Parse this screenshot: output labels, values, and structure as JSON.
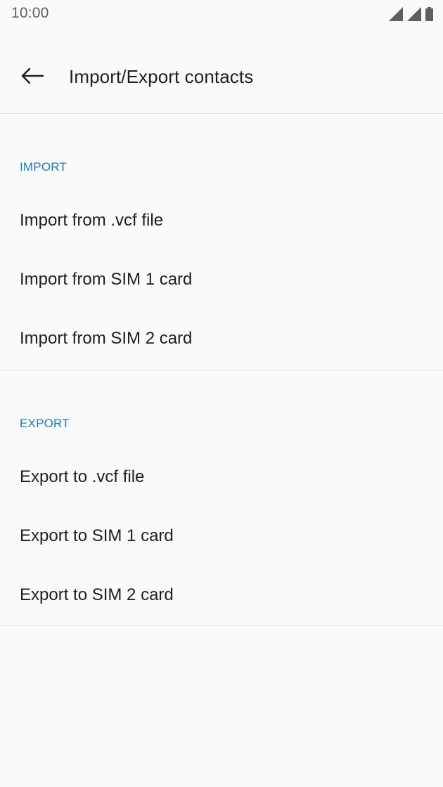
{
  "status_bar": {
    "time": "10:00",
    "icons": [
      "signal-icon",
      "signal-icon",
      "battery-icon"
    ]
  },
  "app_bar": {
    "title": "Import/Export contacts",
    "back_icon": "arrow-left-icon"
  },
  "sections": [
    {
      "header": "IMPORT",
      "items": [
        {
          "label": "Import from .vcf file"
        },
        {
          "label": "Import from SIM 1 card"
        },
        {
          "label": "Import from SIM 2 card"
        }
      ]
    },
    {
      "header": "EXPORT",
      "items": [
        {
          "label": "Export to .vcf file"
        },
        {
          "label": "Export to SIM 1 card"
        },
        {
          "label": "Export to SIM 2 card"
        }
      ]
    }
  ],
  "colors": {
    "accent": "#1a7bc0",
    "background": "#fafafa",
    "divider": "#e3e3e3",
    "text_primary": "#1f1f1f"
  }
}
